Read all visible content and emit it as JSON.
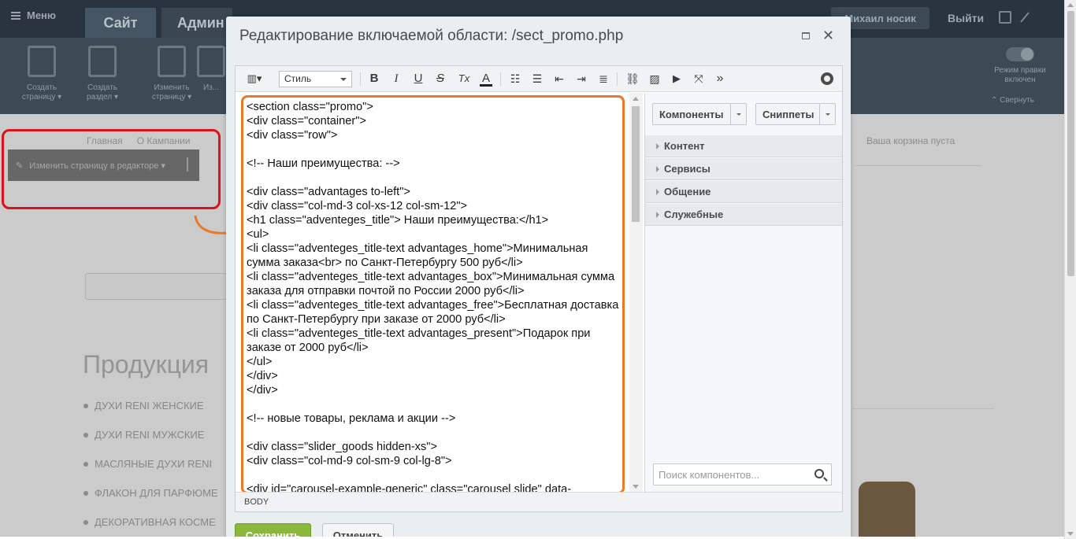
{
  "admin": {
    "menu_label": "Меню",
    "tab_site": "Сайт",
    "tab_admin": "Админ",
    "user_name": "Михаил носик",
    "logout": "Выйти",
    "tools": [
      {
        "label": "Создать страницу ▾"
      },
      {
        "label": "Создать раздел ▾"
      },
      {
        "label": "Изменить страницу ▾"
      },
      {
        "label": "Из..."
      }
    ],
    "edit_mode": "Режим правки включен",
    "collapse": "⌃ Свернуть"
  },
  "page": {
    "breadcrumbs": [
      "Главная",
      "О Кампании"
    ],
    "edit_strip": "Изменить страницу в редакторе ▾",
    "basket": "Ваша корзина пуста",
    "products_heading": "Продукция",
    "categories": [
      "ДУХИ RENI ЖЕНСКИЕ",
      "ДУХИ RENI МУЖСКИЕ",
      "МАСЛЯНЫЕ ДУХИ RENI",
      "ФЛАКОН ДЛЯ ПАРФЮМЕ",
      "ДЕКОРАТИВНАЯ КОСМЕ"
    ]
  },
  "dialog": {
    "title": "Редактирование включаемой области: /sect_promo.php",
    "toolbar": {
      "style_select": "Стиль",
      "bold": "B",
      "italic": "I",
      "underline": "U",
      "strike": "S",
      "clear_format": "Tx",
      "font_color": "A",
      "more": "»"
    },
    "code_lines": [
      "<section class=\"promo\">",
      "<div class=\"container\">",
      "<div class=\"row\">",
      "",
      "<!-- Наши преимущества: -->",
      "",
      "<div class=\"advantages to-left\">",
      "<div class=\"col-md-3 col-xs-12 col-sm-12\">",
      "<h1 class=\"adventeges_title\"> Наши преимущества:</h1>",
      "<ul>",
      "<li class=\"adventeges_title-text advantages_home\">Минимальная сумма заказа<br> по Санкт-Петербургу 500 руб</li>",
      "<li class=\"adventeges_title-text advantages_box\">Минимальная сумма заказа для отправки почтой по России 2000 руб</li>",
      "<li class=\"adventeges_title-text advantages_free\">Бесплатная доставка по Санкт-Петербургу при заказе от 2000 руб</li>",
      "<li class=\"adventeges_title-text advantages_present\">Подарок при заказе от 2000 руб</li>",
      "</ul>",
      "</div>",
      "</div>",
      "",
      "<!-- новые товары, реклама и акции -->",
      "",
      "<div class=\"slider_goods hidden-xs\">",
      "<div class=\"col-md-9 col-sm-9 col-lg-8\">",
      "",
      "<div id=\"carousel-example-generic\" class=\"carousel slide\" data-"
    ],
    "side": {
      "components_btn": "Компоненты",
      "snippets_btn": "Сниппеты",
      "sections": [
        "Контент",
        "Сервисы",
        "Общение",
        "Служебные"
      ],
      "search_placeholder": "Поиск компонентов..."
    },
    "status_path": "BODY",
    "save": "Сохранить",
    "cancel": "Отменить"
  },
  "colors": {
    "save_green": "#8cb73d",
    "highlight_orange": "#e8782b",
    "highlight_red": "#d8131c"
  }
}
